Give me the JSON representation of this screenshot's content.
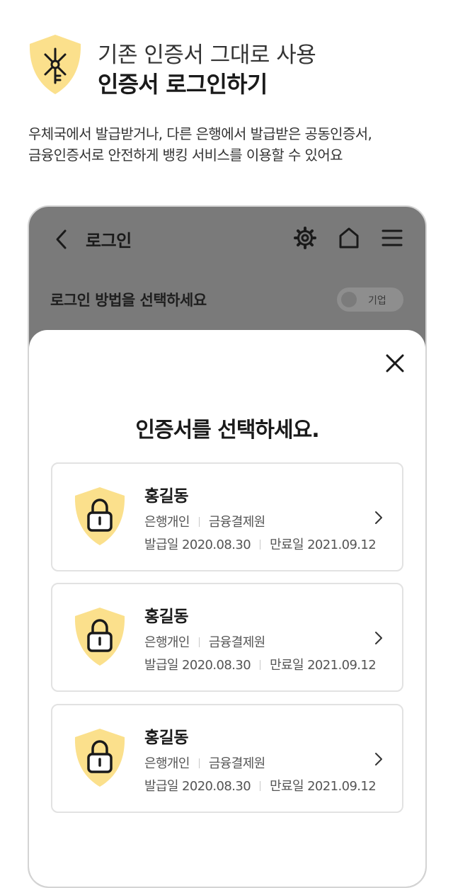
{
  "header": {
    "subtitle": "기존 인증서 그대로 사용",
    "title": "인증서 로그인하기",
    "desc_line1": "우체국에서 발급받거나, 다른 은행에서 발급받은 공동인증서,",
    "desc_line2": "금융인증서로 안전하게 뱅킹 서비스를 이용할 수 있어요"
  },
  "phone": {
    "nav_title": "로그인",
    "method_label": "로그인 방법을 선택하세요",
    "toggle_label": "기업"
  },
  "sheet": {
    "title": "인증서를 선택하세요."
  },
  "certificates": [
    {
      "name": "홍길동",
      "type": "은행개인",
      "issuer": "금융결제원",
      "issued": "발급일 2020.08.30",
      "expires": "만료일 2021.09.12"
    },
    {
      "name": "홍길동",
      "type": "은행개인",
      "issuer": "금융결제원",
      "issued": "발급일 2020.08.30",
      "expires": "만료일 2021.09.12"
    },
    {
      "name": "홍길동",
      "type": "은행개인",
      "issuer": "금융결제원",
      "issued": "발급일 2020.08.30",
      "expires": "만료일 2021.09.12"
    }
  ],
  "colors": {
    "shield_yellow": "#fbe08c",
    "overlay_gray": "#7a7a7a",
    "card_border": "#e2e2e2"
  },
  "icons": [
    "key-shield-icon",
    "back-icon",
    "gear-icon",
    "home-icon",
    "menu-icon",
    "close-icon",
    "lock-shield-icon",
    "chevron-right-icon"
  ]
}
